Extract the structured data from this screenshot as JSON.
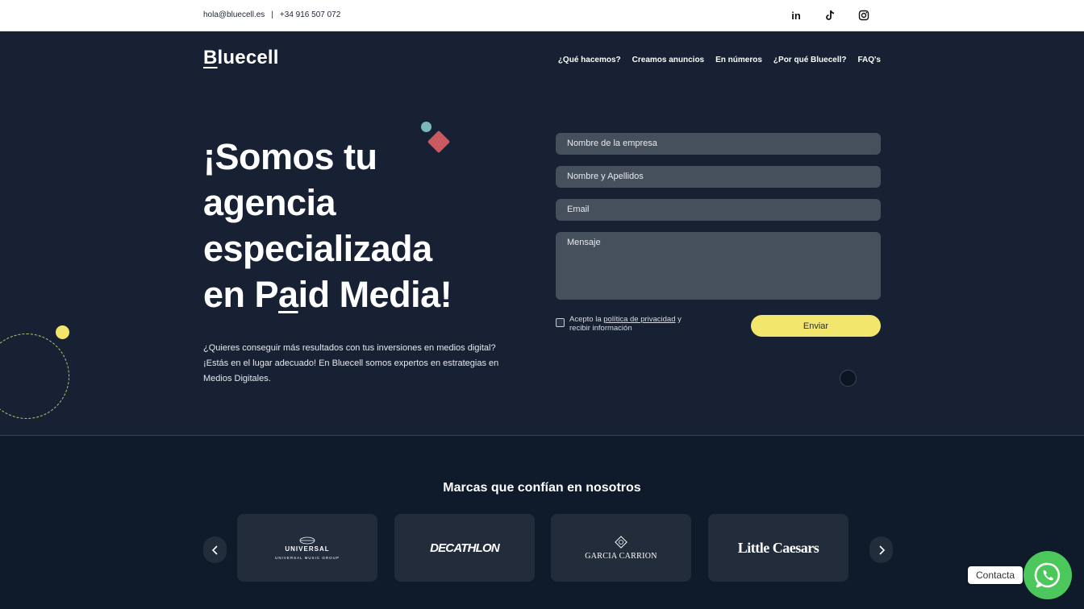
{
  "topbar": {
    "email": "hola@bluecell.es",
    "separator": "|",
    "phone": "+34 916 507 072",
    "social": [
      "linkedin-icon",
      "tiktok-icon",
      "instagram-icon"
    ],
    "linkedin_text": "in"
  },
  "header": {
    "logo_first": "B",
    "logo_rest": "luecell",
    "nav": [
      "¿Qué hacemos?",
      "Creamos anuncios",
      "En números",
      "¿Por qué Bluecell?",
      "FAQ's"
    ]
  },
  "hero": {
    "line1": "¡Somos tu",
    "line2": "agencia",
    "line3": "especializada",
    "line4_a": "en P",
    "line4_u": "a",
    "line4_b": "id Media!",
    "subtext": "¿Quieres conseguir más resultados con tus inversiones en medios digital? ¡Estás en el lugar adecuado! En Bluecell somos expertos en estrategias en Medios Digitales."
  },
  "form": {
    "company_placeholder": "Nombre de la empresa",
    "name_placeholder": "Nombre y Apellidos",
    "email_placeholder": "Email",
    "message_placeholder": "Mensaje",
    "accept_prefix": "Acepto la ",
    "accept_link": "política de privacidad",
    "accept_suffix": " y recibir información",
    "submit": "Enviar"
  },
  "brands": {
    "title": "Marcas que confían en nosotros",
    "items": [
      {
        "name": "UNIVERSAL",
        "sub": "UNIVERSAL MUSIC GROUP"
      },
      {
        "name": "DECATHLON"
      },
      {
        "name": "GARCIA CARRION"
      },
      {
        "name": "Little Caesars"
      }
    ]
  },
  "whatsapp": {
    "label": "Contacta",
    "color": "#4bc75b"
  },
  "colors": {
    "background": "#172133",
    "accent_yellow": "#f3e66d",
    "accent_red": "#c95a62",
    "accent_teal": "#7ab8bd"
  }
}
